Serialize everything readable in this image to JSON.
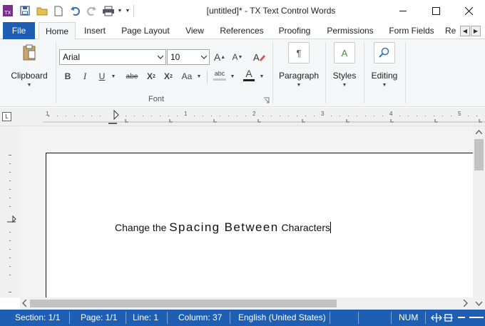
{
  "window": {
    "title": "[untitled]* - TX Text Control Words",
    "app_icon_text": "TX"
  },
  "tabs": [
    {
      "label": "File"
    },
    {
      "label": "Home"
    },
    {
      "label": "Insert"
    },
    {
      "label": "Page Layout"
    },
    {
      "label": "View"
    },
    {
      "label": "References"
    },
    {
      "label": "Proofing"
    },
    {
      "label": "Permissions"
    },
    {
      "label": "Form Fields"
    },
    {
      "label": "Re"
    }
  ],
  "ribbon": {
    "clipboard_label": "Clipboard",
    "font_name": "Arial",
    "font_size": "10",
    "font_group_label": "Font",
    "paragraph_label": "Paragraph",
    "styles_label": "Styles",
    "editing_label": "Editing",
    "bold": "B",
    "italic": "I",
    "underline": "U",
    "strikethrough": "abe",
    "subscript": "X",
    "subscript_mark": "2",
    "superscript": "X",
    "superscript_mark": "2",
    "change_case": "Aa",
    "grow_font": "A",
    "shrink_font": "A",
    "font_color": "A",
    "highlight": "abc",
    "paragraph_icon": "¶",
    "styles_icon": "A"
  },
  "ruler": {
    "numbers": [
      "1",
      "1",
      "2",
      "3",
      "4",
      "5"
    ],
    "corner": "L"
  },
  "document": {
    "part1": "Change the ",
    "part2": "Spacing Between",
    "part3": " Characters"
  },
  "status": {
    "section": "Section: 1/1",
    "page": "Page: 1/1",
    "line": "Line: 1",
    "column": "Column: 37",
    "language": "English (United States)",
    "num": "NUM"
  },
  "colors": {
    "accent": "#1e5fb4",
    "ribbon_bg": "#f5f6f7"
  }
}
